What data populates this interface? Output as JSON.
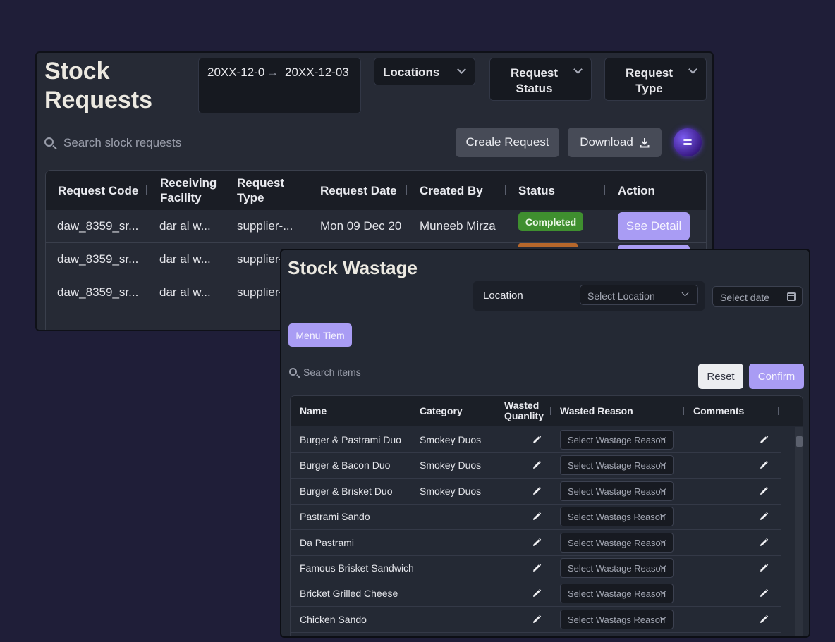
{
  "requests": {
    "title_line1": "Stock",
    "title_line2": "Requests",
    "date_from": "20XX-12-0",
    "date_arrow": "→",
    "date_to": "20XX-12-03",
    "locations_label": "Locations",
    "request_status_line1": "Request",
    "request_status_line2": "Status",
    "request_type_line1": "Request",
    "request_type_line2": "Type",
    "search_placeholder": "Search slock requests",
    "create_label": "Creale Request",
    "download_label": "Download",
    "columns": {
      "code": "Request Code",
      "facility_line1": "Receiving",
      "facility_line2": "Facility",
      "type_line1": "Request",
      "type_line2": "Type",
      "date": "Request Date",
      "created_by": "Created By",
      "status": "Status",
      "action": "Action"
    },
    "rows": [
      {
        "code": "daw_8359_sr...",
        "facility": "dar al w...",
        "type": "supplier-...",
        "date": "Mon 09 Dec 20",
        "created_by": "Muneeb Mirza",
        "status": "Completed",
        "action": "See Detail"
      },
      {
        "code": "daw_8359_sr...",
        "facility": "dar al w...",
        "type": "supplier-"
      },
      {
        "code": "daw_8359_sr...",
        "facility": "dar al w...",
        "type": "supplier-"
      }
    ]
  },
  "wastage": {
    "title": "Stock Wastage",
    "location_label": "Location",
    "location_placeholder": "Select Location",
    "date_placeholder": "Select date",
    "menu_item_label": "Menu Tiem",
    "search_placeholder": "Search items",
    "reset_label": "Reset",
    "confirm_label": "Confirm",
    "columns": {
      "name": "Name",
      "category": "Category",
      "wasted_qty_line1": "Wasted",
      "wasted_qty_line2": "Quanlity",
      "reason": "Wasted Reason",
      "comments": "Comments"
    },
    "rows": [
      {
        "name": "Burger & Pastrami Duo",
        "category": "Smokey Duos",
        "reason": "Select Wastage Reason"
      },
      {
        "name": "Burger & Bacon Duo",
        "category": "Smokey Duos",
        "reason": "Select Wastage Reason"
      },
      {
        "name": "Burger & Brisket Duo",
        "category": "Smokey Duos",
        "reason": "Select Wastage Reason"
      },
      {
        "name": "Pastrami Sando",
        "category": "",
        "reason": "Select Wastags Reason"
      },
      {
        "name": "Da Pastrami",
        "category": "",
        "reason": "Select Wastage Reason"
      },
      {
        "name": "Famous Brisket Sandwich",
        "category": "",
        "reason": "Select Wastage Reason"
      },
      {
        "name": "Bricket Grilled Cheese",
        "category": "",
        "reason": "Select Wastage Reason"
      },
      {
        "name": "Chicken Sando",
        "category": "",
        "reason": "Select Wastags Reason"
      }
    ]
  },
  "colors": {
    "background": "#1f1e38",
    "accent": "#a99cf4",
    "completed": "#3f8f2f"
  }
}
